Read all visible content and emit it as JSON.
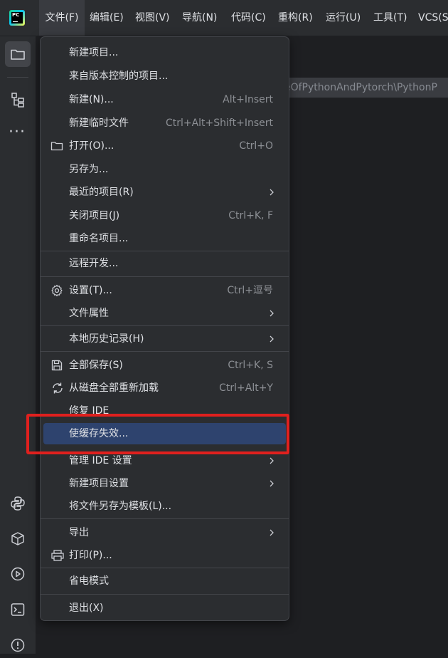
{
  "menubar": {
    "logo_text": "PC",
    "items": [
      {
        "label": "文件(F)",
        "active": true
      },
      {
        "label": "编辑(E)"
      },
      {
        "label": "视图(V)"
      },
      {
        "label": "导航(N)"
      },
      {
        "label": "代码(C)"
      },
      {
        "label": "重构(R)"
      },
      {
        "label": "运行(U)"
      },
      {
        "label": "工具(T)"
      },
      {
        "label": "VCS(S)"
      }
    ]
  },
  "path_text": "eOfPythonAndPytorch\\PythonP",
  "toolstrip": {
    "top_icons": [
      "folder-icon",
      "structure-icon",
      "more-icon"
    ],
    "bottom_icons": [
      "python-console-icon",
      "python-packages-icon",
      "run-icon",
      "terminal-icon",
      "problems-icon"
    ]
  },
  "file_menu": {
    "items": [
      {
        "label": "新建项目...",
        "shortcut": ""
      },
      {
        "label": "来自版本控制的项目...",
        "shortcut": ""
      },
      {
        "label": "新建(N)...",
        "shortcut": "Alt+Insert"
      },
      {
        "label": "新建临时文件",
        "shortcut": "Ctrl+Alt+Shift+Insert"
      },
      {
        "label": "打开(O)...",
        "shortcut": "Ctrl+O",
        "icon": "folder-icon"
      },
      {
        "label": "另存为...",
        "shortcut": ""
      },
      {
        "label": "最近的项目(R)",
        "shortcut": "",
        "submenu": true
      },
      {
        "label": "关闭项目(J)",
        "shortcut": "Ctrl+K, F"
      },
      {
        "label": "重命名项目...",
        "shortcut": ""
      },
      {
        "label": "远程开发...",
        "shortcut": ""
      },
      {
        "label": "设置(T)...",
        "shortcut": "Ctrl+逗号",
        "icon": "gear-icon"
      },
      {
        "label": "文件属性",
        "shortcut": "",
        "submenu": true
      },
      {
        "label": "本地历史记录(H)",
        "shortcut": "",
        "submenu": true
      },
      {
        "label": "全部保存(S)",
        "shortcut": "Ctrl+K, S",
        "icon": "save-icon"
      },
      {
        "label": "从磁盘全部重新加载",
        "shortcut": "Ctrl+Alt+Y",
        "icon": "reload-icon"
      },
      {
        "label": "修复 IDE",
        "shortcut": ""
      },
      {
        "label": "使缓存失效...",
        "shortcut": "",
        "highlighted": true
      },
      {
        "label": "管理 IDE 设置",
        "shortcut": "",
        "submenu": true
      },
      {
        "label": "新建项目设置",
        "shortcut": "",
        "submenu": true
      },
      {
        "label": "将文件另存为模板(L)...",
        "shortcut": ""
      },
      {
        "label": "导出",
        "shortcut": "",
        "submenu": true
      },
      {
        "label": "打印(P)...",
        "shortcut": "",
        "icon": "print-icon"
      },
      {
        "label": "省电模式",
        "shortcut": ""
      },
      {
        "label": "退出(X)",
        "shortcut": ""
      }
    ]
  },
  "colors": {
    "background": "#1e1f22",
    "panel": "#2b2d30",
    "highlight": "#2e436e",
    "annotation_box": "#e0201e"
  }
}
